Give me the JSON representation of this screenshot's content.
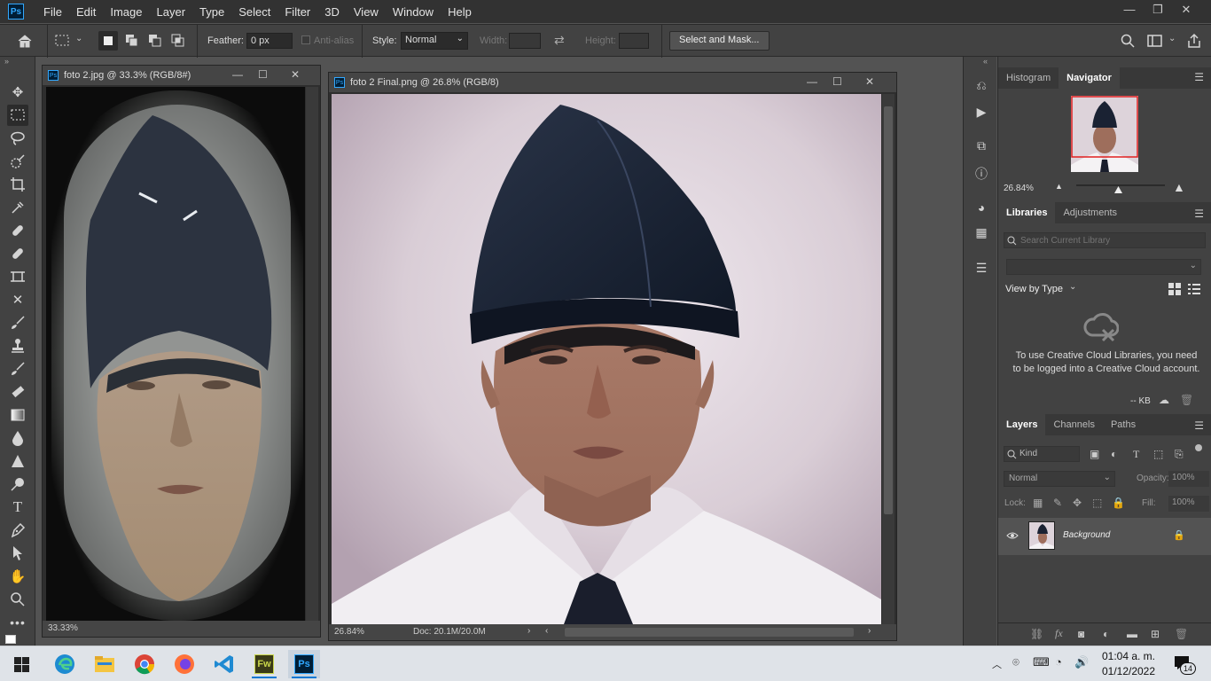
{
  "menu": [
    "File",
    "Edit",
    "Image",
    "Layer",
    "Type",
    "Select",
    "Filter",
    "3D",
    "View",
    "Window",
    "Help"
  ],
  "app_logo": "Ps",
  "window_controls": [
    "—",
    "❐",
    "✕"
  ],
  "options": {
    "feather_label": "Feather:",
    "feather_value": "0 px",
    "antialias_label": "Anti-alias",
    "style_label": "Style:",
    "style_value": "Normal",
    "width_label": "Width:",
    "height_label": "Height:",
    "select_mask": "Select and Mask..."
  },
  "doc1": {
    "title": "foto 2.jpg @ 33.3% (RGB/8#)",
    "zoom": "33.33%"
  },
  "doc2": {
    "title": "foto 2 Final.png @ 26.8% (RGB/8)",
    "zoom": "26.84%",
    "doc_info": "Doc: 20.1M/20.0M"
  },
  "navigator": {
    "tab1": "Histogram",
    "tab2": "Navigator",
    "zoom": "26.84%",
    "slider_position": 0.47
  },
  "libraries": {
    "tab1": "Libraries",
    "tab2": "Adjustments",
    "search_placeholder": "Search Current Library",
    "view_by": "View by Type",
    "message": "To use Creative Cloud Libraries, you need to be logged into a Creative Cloud account.",
    "kb": "-- KB"
  },
  "layers": {
    "tab1": "Layers",
    "tab2": "Channels",
    "tab3": "Paths",
    "kind_placeholder": "Kind",
    "blend": "Normal",
    "opacity_label": "Opacity:",
    "opacity": "100%",
    "lock_label": "Lock:",
    "fill_label": "Fill:",
    "fill": "100%",
    "layer_name": "Background"
  },
  "taskbar": {
    "time": "01:04 a. m.",
    "date": "01/12/2022",
    "notif_count": "14"
  },
  "colors": {
    "accent": "#31a8ff",
    "panel": "#424242",
    "bg": "#535353"
  }
}
